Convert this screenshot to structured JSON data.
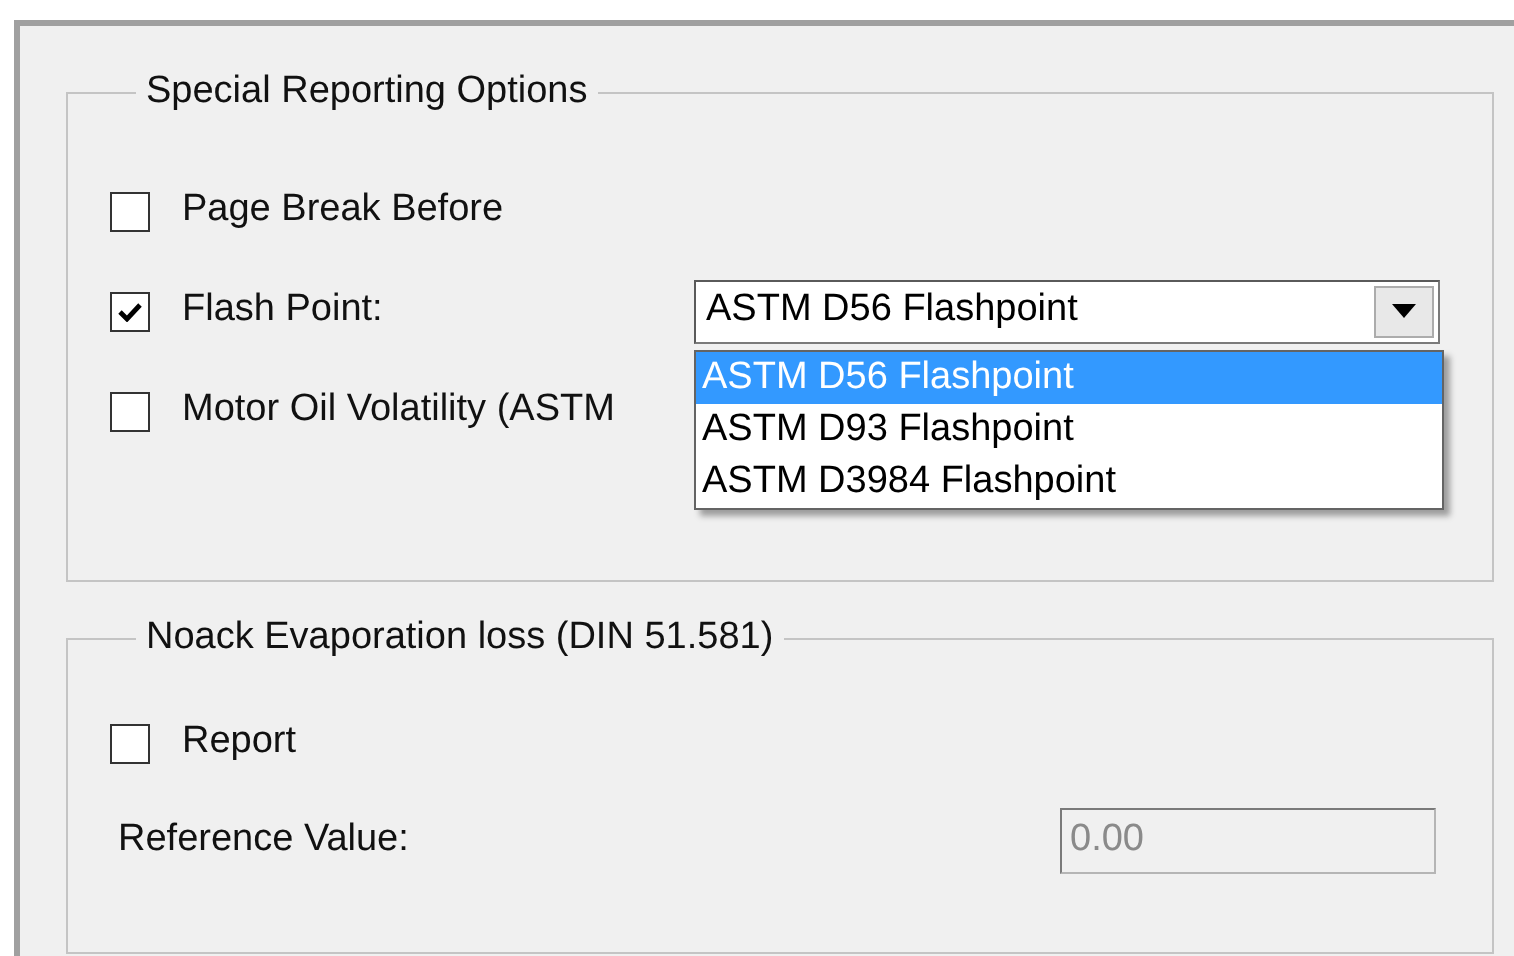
{
  "groups": [
    {
      "title": "Special Reporting Options",
      "rows": [
        {
          "kind": "checkbox",
          "label": "Page Break Before",
          "checked": false
        },
        {
          "kind": "checkbox_combo",
          "label": "Flash Point:",
          "checked": true,
          "combo": {
            "value": "ASTM D56 Flashpoint",
            "expanded": true,
            "options": [
              {
                "label": "ASTM D56 Flashpoint",
                "selected": true
              },
              {
                "label": "ASTM D93 Flashpoint",
                "selected": false
              },
              {
                "label": "ASTM D3984 Flashpoint",
                "selected": false
              }
            ]
          }
        },
        {
          "kind": "checkbox",
          "label": "Motor Oil Volatility (ASTM",
          "checked": false
        }
      ]
    },
    {
      "title": "Noack Evaporation loss (DIN 51.581)",
      "rows": [
        {
          "kind": "checkbox",
          "label": "Report",
          "checked": false
        },
        {
          "kind": "field",
          "label": "Reference Value:",
          "value": "0.00",
          "disabled": true
        }
      ]
    }
  ]
}
